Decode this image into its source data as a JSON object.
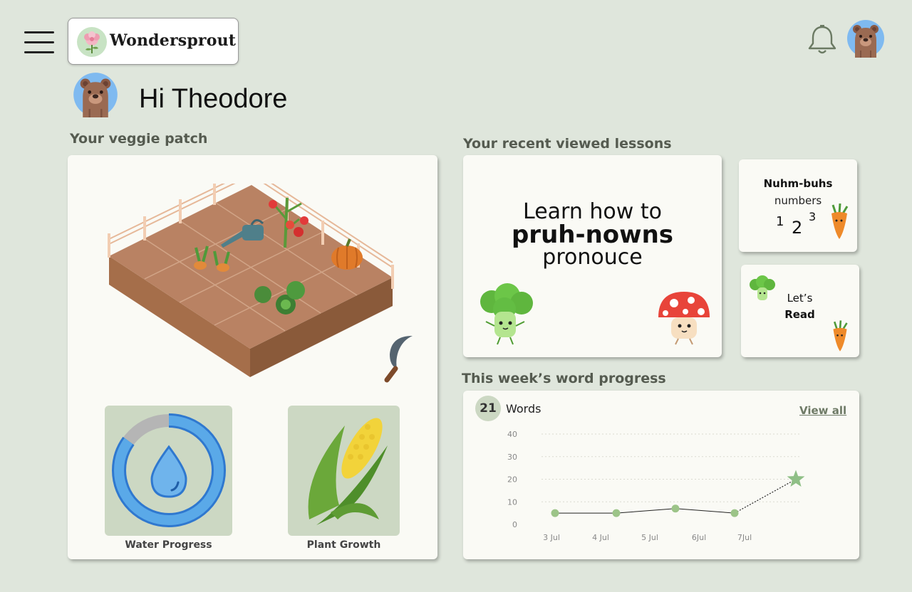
{
  "header": {
    "logo_text": "Wondersprout",
    "menu_icon": "hamburger-menu-icon",
    "notification_icon": "bell-icon",
    "avatar_icon": "bear-avatar-icon"
  },
  "greeting": "Hi Theodore",
  "veggie_patch": {
    "title": "Your veggie patch",
    "tiles": [
      {
        "label": "Water Progress",
        "icon": "water-drop-icon",
        "progress": 0.85
      },
      {
        "label": "Plant Growth",
        "icon": "corn-icon"
      }
    ]
  },
  "lessons": {
    "title": "Your recent viewed lessons",
    "main": {
      "line1": "Learn how to",
      "line2": "pruh-nowns",
      "line3": "pronouce"
    },
    "numbers": {
      "title": "Nuhm-buhs",
      "subtitle": "numbers",
      "n1": "1",
      "n2": "2",
      "n3": "3"
    },
    "read": {
      "line1": "Let’s",
      "line2": "Read"
    }
  },
  "word_progress": {
    "title": "This week’s word progress",
    "count": "21",
    "count_label": "Words",
    "view_all": "View all"
  },
  "chart_data": {
    "type": "line",
    "categories": [
      "3 Jul",
      "4 Jul",
      "5 Jul",
      "6Jul",
      "7Jul"
    ],
    "values": [
      5,
      5,
      7,
      5
    ],
    "projected": {
      "value": 20,
      "marker": "star"
    },
    "yticks": [
      "40",
      "30",
      "20",
      "10",
      "0"
    ],
    "ylim": [
      0,
      40
    ],
    "grid": true,
    "colors": {
      "point": "#9cc488",
      "line": "#222222",
      "star": "#8fbf86"
    }
  }
}
